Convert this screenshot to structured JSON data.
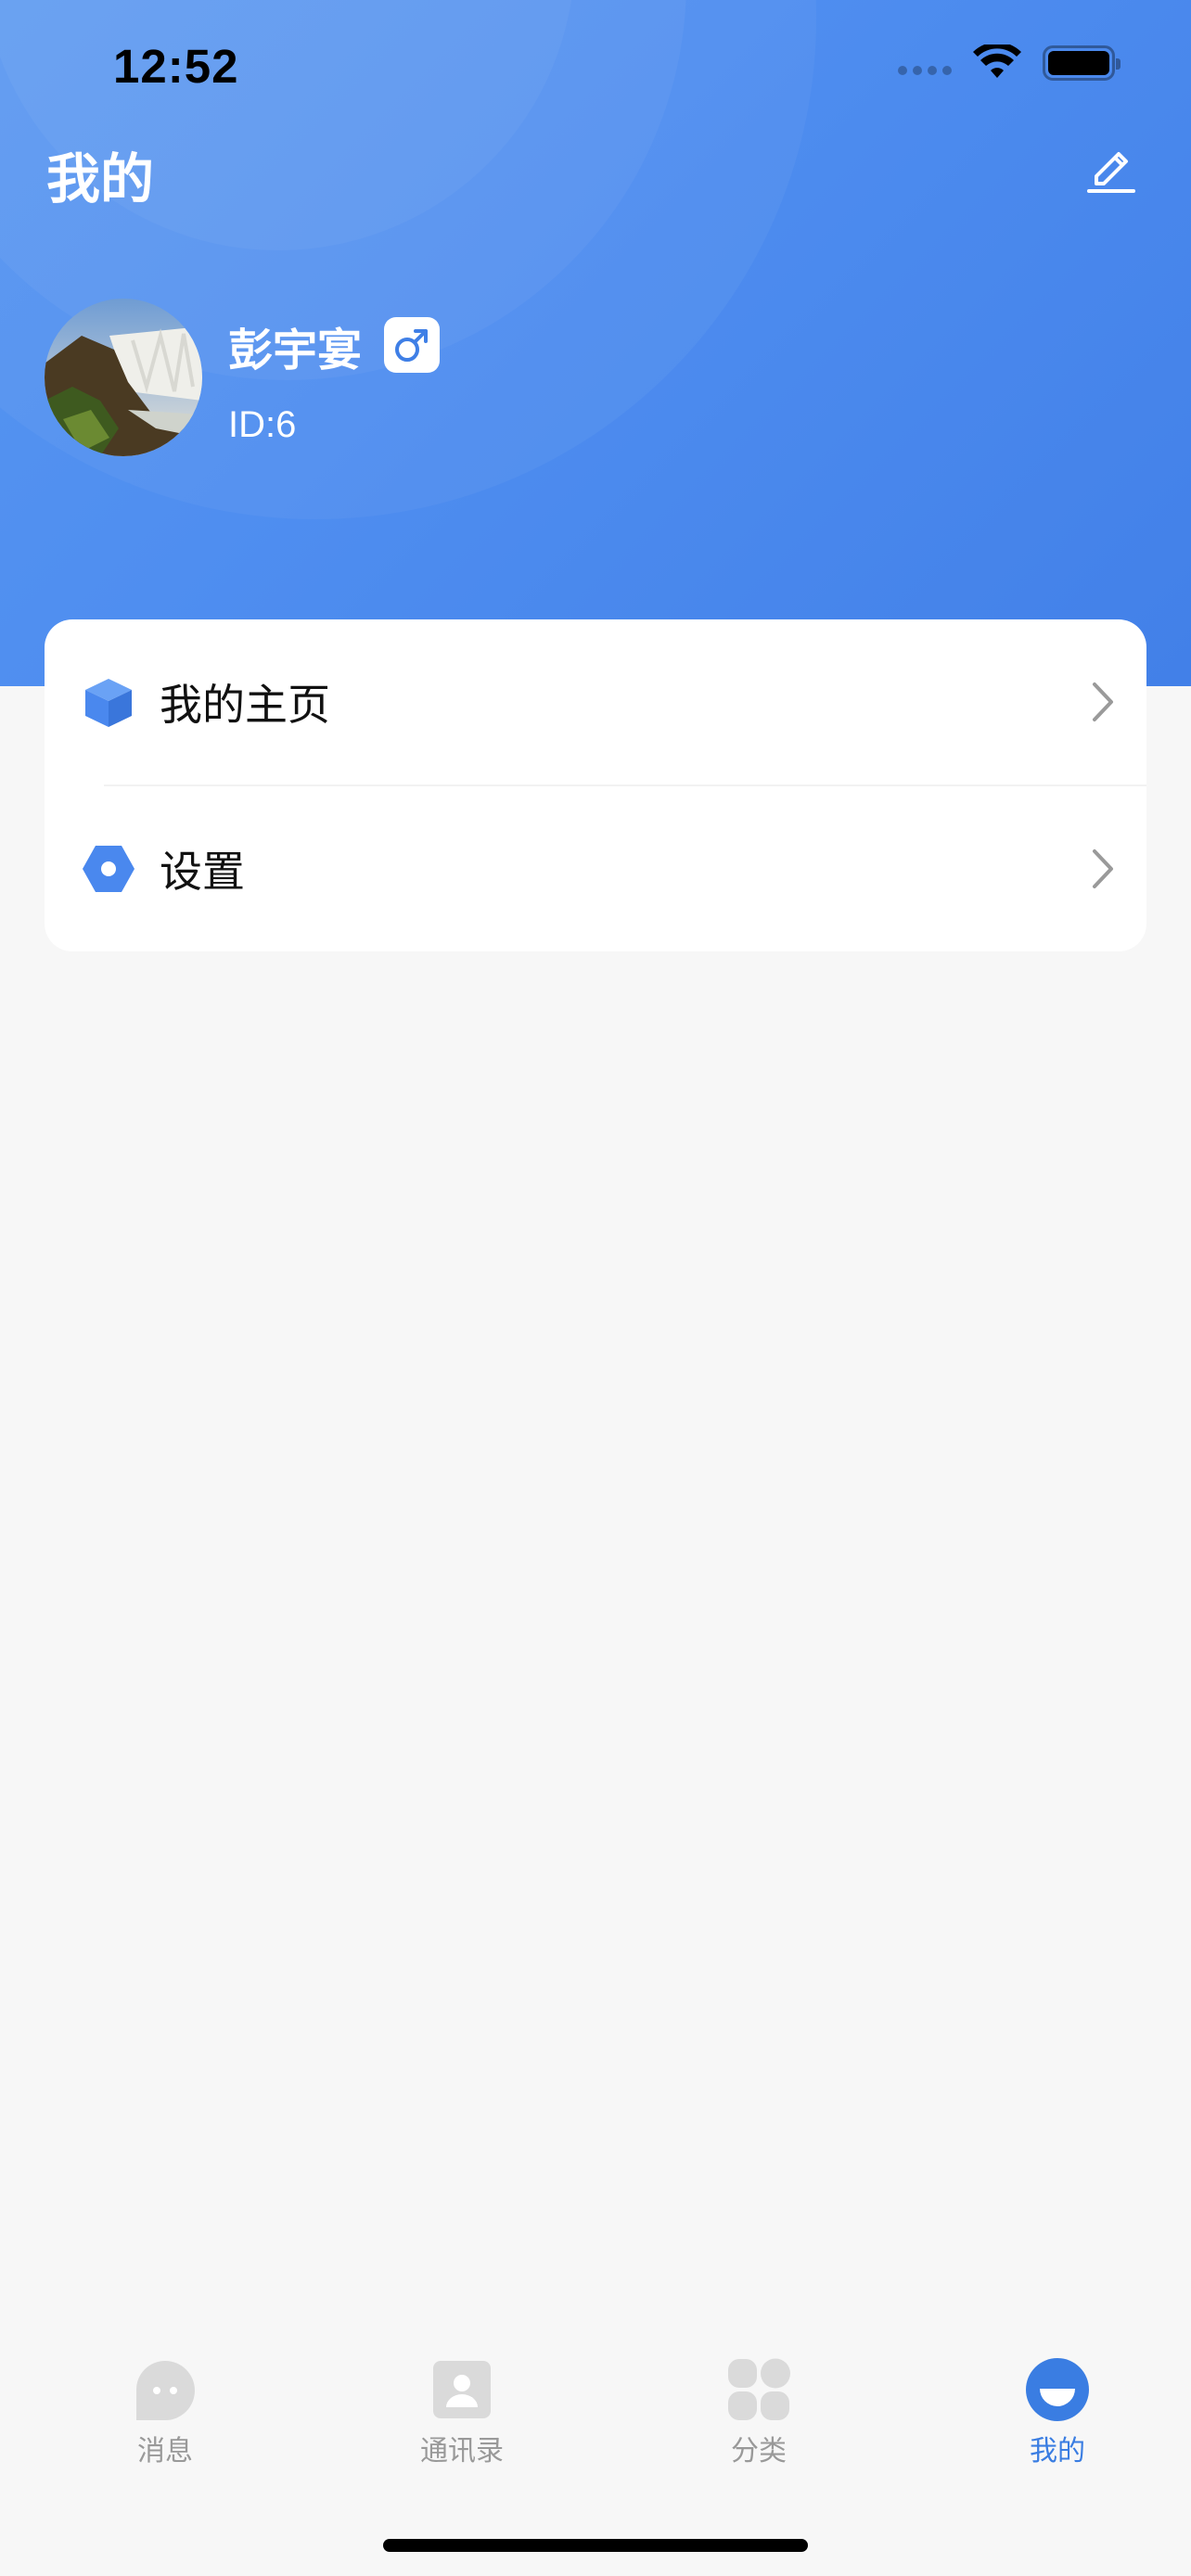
{
  "status_bar": {
    "time": "12:52"
  },
  "header": {
    "title": "我的",
    "edit_icon": "edit-pencil-icon"
  },
  "profile": {
    "name": "彭宇宴",
    "gender_symbol": "♂",
    "id_text": "ID:6",
    "avatar_subject": "waterfall landscape photo"
  },
  "menu": {
    "items": [
      {
        "label": "我的主页",
        "icon": "cube-icon"
      },
      {
        "label": "设置",
        "icon": "hexagon-settings-icon"
      }
    ]
  },
  "tabbar": {
    "tabs": [
      {
        "label": "消息",
        "icon": "chat-bubble-icon",
        "active": false
      },
      {
        "label": "通讯录",
        "icon": "contacts-icon",
        "active": false
      },
      {
        "label": "分类",
        "icon": "category-grid-icon",
        "active": false
      },
      {
        "label": "我的",
        "icon": "profile-face-icon",
        "active": true
      }
    ]
  },
  "colors": {
    "brand_blue": "#4a88ee",
    "active_tab": "#3a7de2",
    "inactive_tab": "#999999",
    "background": "#f7f7f7"
  }
}
